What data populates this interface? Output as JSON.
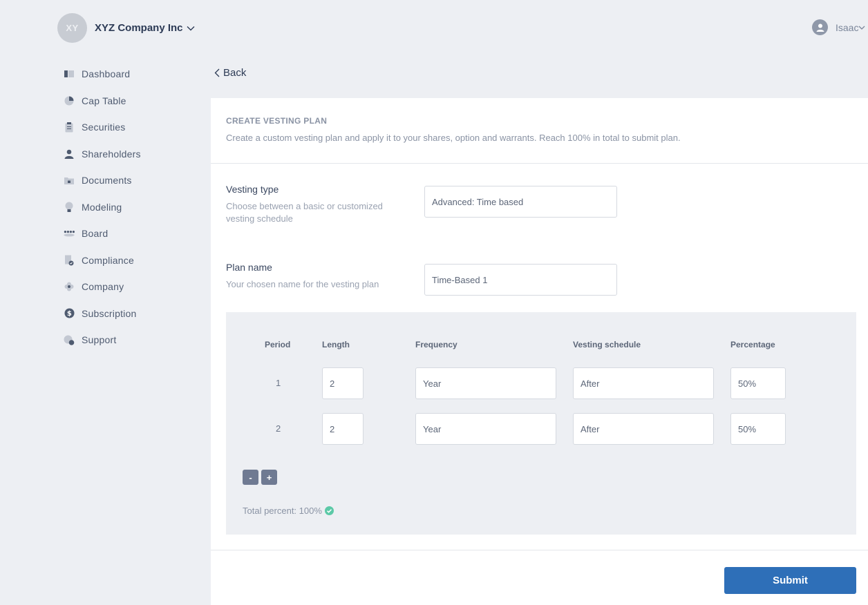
{
  "header": {
    "company_initials": "XY",
    "company_name": "XYZ Company Inc",
    "user_name": "Isaac"
  },
  "sidebar": {
    "items": [
      {
        "label": "Dashboard",
        "icon": "dashboard-icon"
      },
      {
        "label": "Cap Table",
        "icon": "pie-chart-icon"
      },
      {
        "label": "Securities",
        "icon": "clipboard-icon"
      },
      {
        "label": "Shareholders",
        "icon": "person-icon"
      },
      {
        "label": "Documents",
        "icon": "folder-lock-icon"
      },
      {
        "label": "Modeling",
        "icon": "lightbulb-icon"
      },
      {
        "label": "Board",
        "icon": "people-group-icon"
      },
      {
        "label": "Compliance",
        "icon": "document-check-icon"
      },
      {
        "label": "Company",
        "icon": "flower-icon"
      },
      {
        "label": "Subscription",
        "icon": "dollar-coin-icon"
      },
      {
        "label": "Support",
        "icon": "chat-support-icon"
      }
    ]
  },
  "back_label": "Back",
  "card": {
    "title": "CREATE VESTING PLAN",
    "description": "Create a custom vesting plan and apply it to your shares, option and warrants. Reach 100% in total to submit plan."
  },
  "vesting_type": {
    "label": "Vesting type",
    "help": "Choose between a basic or customized vesting schedule",
    "value": "Advanced: Time based"
  },
  "plan_name": {
    "label": "Plan name",
    "help": "Your chosen name for the vesting plan",
    "value": "Time-Based 1"
  },
  "periods": {
    "headers": [
      "Period",
      "Length",
      "Frequency",
      "Vesting schedule",
      "Percentage"
    ],
    "rows": [
      {
        "period": "1",
        "length": "2",
        "frequency": "Year",
        "schedule": "After",
        "percentage": "50%"
      },
      {
        "period": "2",
        "length": "2",
        "frequency": "Year",
        "schedule": "After",
        "percentage": "50%"
      }
    ],
    "remove_label": "-",
    "add_label": "+",
    "total_label": "Total percent: 100%"
  },
  "submit_label": "Submit",
  "colors": {
    "background": "#edeff3",
    "primary": "#2e6fb8",
    "success": "#5cc9a7",
    "step_button": "#6f7a92"
  }
}
